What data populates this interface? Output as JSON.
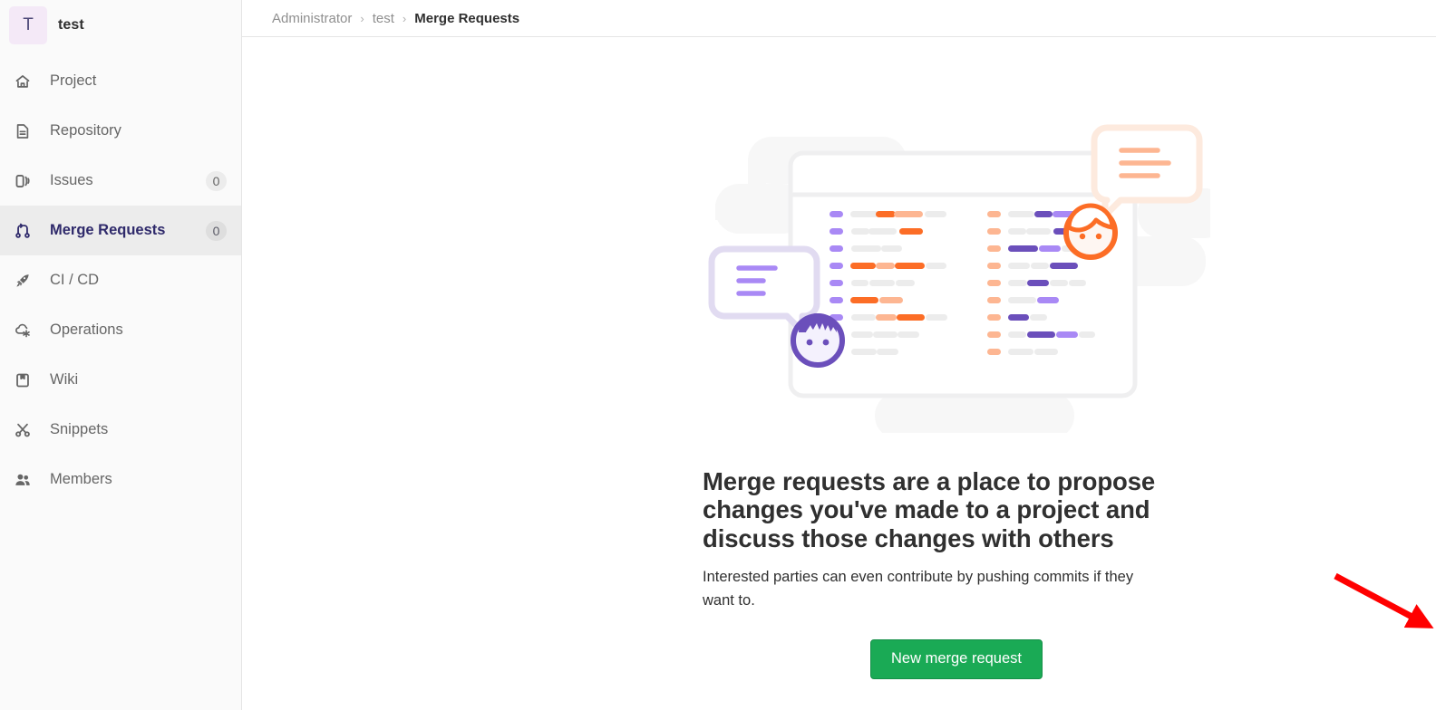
{
  "sidebar": {
    "project": {
      "avatar_letter": "T",
      "name": "test"
    },
    "items": [
      {
        "label": "Project",
        "icon": "home-icon",
        "badge": null,
        "active": false
      },
      {
        "label": "Repository",
        "icon": "document-icon",
        "badge": null,
        "active": false
      },
      {
        "label": "Issues",
        "icon": "issues-icon",
        "badge": "0",
        "active": false
      },
      {
        "label": "Merge Requests",
        "icon": "merge-request-icon",
        "badge": "0",
        "active": true
      },
      {
        "label": "CI / CD",
        "icon": "rocket-icon",
        "badge": null,
        "active": false
      },
      {
        "label": "Operations",
        "icon": "cloud-gear-icon",
        "badge": null,
        "active": false
      },
      {
        "label": "Wiki",
        "icon": "book-icon",
        "badge": null,
        "active": false
      },
      {
        "label": "Snippets",
        "icon": "scissors-icon",
        "badge": null,
        "active": false
      },
      {
        "label": "Members",
        "icon": "users-icon",
        "badge": null,
        "active": false
      }
    ]
  },
  "breadcrumb": {
    "root": "Administrator",
    "separator": "›",
    "project": "test",
    "current": "Merge Requests"
  },
  "empty_state": {
    "illustration_name": "merge-request-empty-illustration",
    "title": "Merge requests are a place to propose changes you've made to a project and discuss those changes with others",
    "description": "Interested parties can even contribute by pushing commits if they want to.",
    "primary_button": "New merge request"
  },
  "annotation": {
    "arrow_color": "#ff0000",
    "name": "red-pointer-arrow"
  },
  "colors": {
    "accent_green": "#1aaa55",
    "active_nav_text": "#2f2a6b",
    "sidebar_bg": "#fafafa",
    "illustration_orange": "#fc6d26",
    "illustration_orange_light": "#fca326",
    "illustration_purple": "#6b4fbb",
    "illustration_purple_light": "#a989f5",
    "gray_line": "#ececec"
  }
}
